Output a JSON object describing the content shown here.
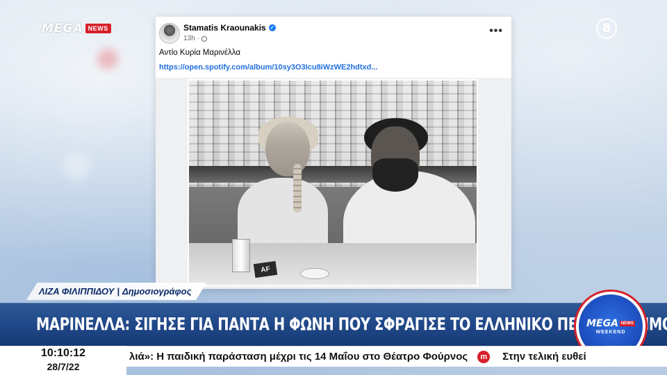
{
  "channel": {
    "logo_text": "MEGA",
    "news_tag": "NEWS",
    "bug_number": "8"
  },
  "post": {
    "author": "Stamatis Kraounakis",
    "time": "13h",
    "text": "Αντίο Κυρία Μαρινέλλα",
    "link": "https://open.spotify.com/album/10sy3O3Icu8iWzWE2hdtxd..."
  },
  "reporter": {
    "name": "ΛΙΖΑ ΦΙΛΙΠΠΙΔΟΥ",
    "separator": "|",
    "role": "Δημοσιογράφος"
  },
  "headline": "ΜΑΡΙΝΕΛΛΑ: ΣΙΓΗΣΕ ΓΙΑ ΠΑΝΤΑ Η ΦΩΝΗ ΠΟΥ ΣΦΡΑΓΙΣΕ ΤΟ ΕΛΛΗΝΙΚΟ ΠΕΝΤΑΓΡΑΜΜΟ",
  "weekend_logo": {
    "mega": "MEGA",
    "news": "NEWS",
    "weekend": "WEEKEND"
  },
  "photo_card_text": "AF",
  "ticker": {
    "time": "10:10:12",
    "date": "28/7/22",
    "item1": "λιά»: Η παιδική παράσταση μέχρι τις 14 Μαΐου στο Θέατρο Φούρνος",
    "logo_glyph": "m",
    "item2": "Στην τελική ευθεί"
  },
  "colors": {
    "headline_bar": "#1f4687",
    "reporter_text": "#0a2a6a",
    "brand_red": "#d6202a",
    "link": "#216fdb"
  }
}
